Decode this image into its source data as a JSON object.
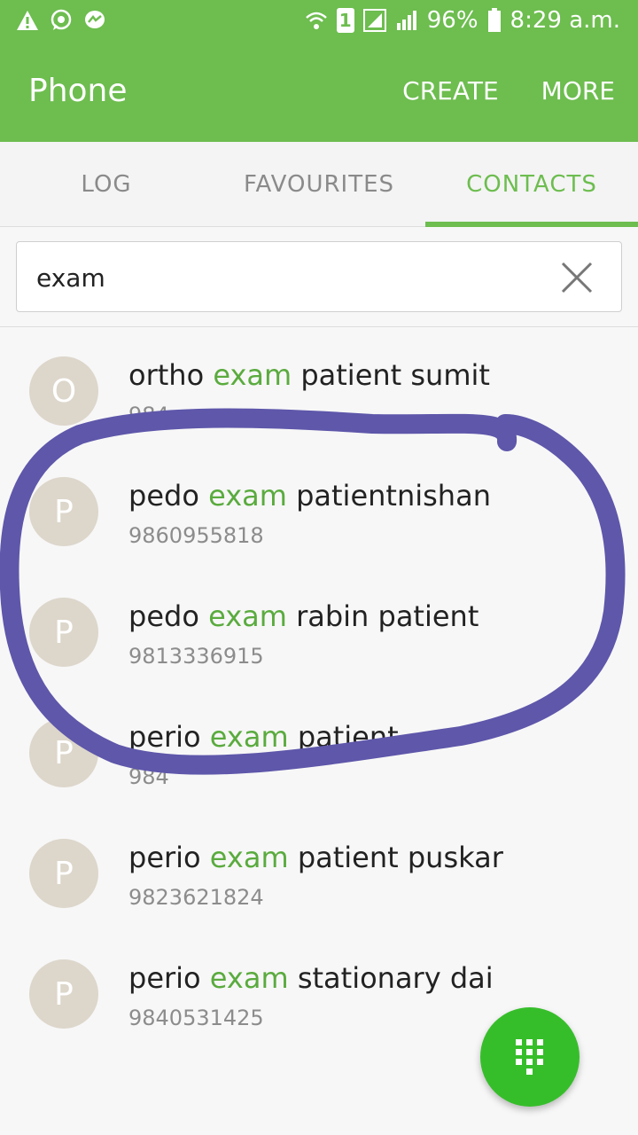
{
  "status": {
    "battery_text": "96%",
    "time_text": "8:29 a.m.",
    "sim_badge": "1",
    "icons_left": [
      "warning-icon",
      "whatsapp-icon",
      "messenger-icon"
    ],
    "icons_right": [
      "wifi-icon",
      "sim-icon",
      "signal-icon",
      "signal-icon",
      "battery-icon"
    ]
  },
  "appbar": {
    "title": "Phone",
    "create_label": "CREATE",
    "more_label": "MORE"
  },
  "tabs": [
    {
      "label": "LOG",
      "active": false
    },
    {
      "label": "FAVOURITES",
      "active": false
    },
    {
      "label": "CONTACTS",
      "active": true
    }
  ],
  "search": {
    "value": "exam",
    "clear_icon": "close-icon"
  },
  "contacts": [
    {
      "initial": "O",
      "name_prefix": "ortho ",
      "name_match": "exam",
      "name_suffix": " patient sumit",
      "phone": "984"
    },
    {
      "initial": "P",
      "name_prefix": "pedo ",
      "name_match": "exam",
      "name_suffix": " patientnishan",
      "phone": "9860955818"
    },
    {
      "initial": "P",
      "name_prefix": "pedo ",
      "name_match": "exam",
      "name_suffix": " rabin patient",
      "phone": "9813336915"
    },
    {
      "initial": "P",
      "name_prefix": "perio ",
      "name_match": "exam",
      "name_suffix": " patient",
      "phone": "984"
    },
    {
      "initial": "P",
      "name_prefix": "perio ",
      "name_match": "exam",
      "name_suffix": " patient puskar",
      "phone": "9823621824"
    },
    {
      "initial": "P",
      "name_prefix": "perio ",
      "name_match": "exam",
      "name_suffix": " stationary dai",
      "phone": "9840531425"
    }
  ],
  "colors": {
    "accent": "#6dbd4f",
    "highlight": "#5aab3e",
    "fab": "#36be2a",
    "annotation": "#5e57aa"
  },
  "fab_icon": "dialpad-icon"
}
